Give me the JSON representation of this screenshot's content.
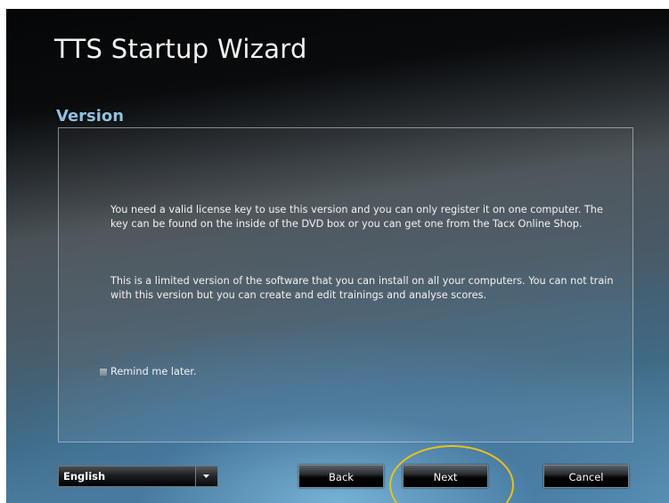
{
  "window": {
    "title": "TTS Startup Wizard",
    "section_title": "Version"
  },
  "content": {
    "paragraph1": "You need a valid license key to use this version and you can only register it on one computer. The key can be found on the inside of the DVD box or you can get one from the Tacx Online Shop.",
    "paragraph2": "This is a limited version of the software that you can install on all your computers. You can not train with this version but you can create and edit trainings and analyse scores.",
    "remind_label": "Remind me later.",
    "remind_checked": false
  },
  "footer": {
    "language": "English",
    "back_label": "Back",
    "next_label": "Next",
    "cancel_label": "Cancel"
  },
  "colors": {
    "highlight": "#e6c21e",
    "section_title": "#8fc0de"
  }
}
